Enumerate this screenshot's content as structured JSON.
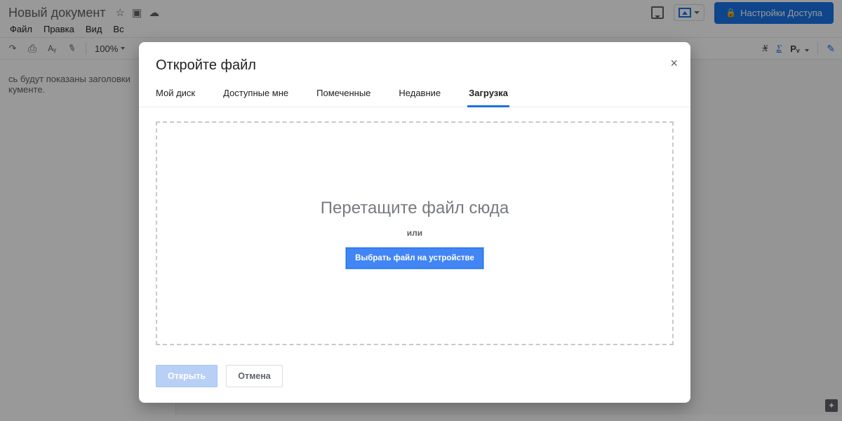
{
  "header": {
    "doc_title": "Новый документ",
    "icons": {
      "star": "star-icon",
      "folder": "move-to-folder-icon",
      "cloud": "cloud-status-icon"
    },
    "share_label": "Настройки Доступа"
  },
  "menubar": [
    "Файл",
    "Правка",
    "Вид",
    "Вс"
  ],
  "toolbar": {
    "zoom": "100%",
    "right": {
      "label_pv": "Pᵥ"
    }
  },
  "outline": {
    "placeholder": "сь будут показаны заголовки кументе."
  },
  "dialog": {
    "title": "Откройте файл",
    "tabs": [
      {
        "label": "Мой диск",
        "active": false
      },
      {
        "label": "Доступные мне",
        "active": false
      },
      {
        "label": "Помеченные",
        "active": false
      },
      {
        "label": "Недавние",
        "active": false
      },
      {
        "label": "Загрузка",
        "active": true
      }
    ],
    "dropzone": {
      "headline": "Перетащите файл сюда",
      "or": "или",
      "pick": "Выбрать файл на устройстве"
    },
    "footer": {
      "open": "Открыть",
      "cancel": "Отмена"
    }
  }
}
